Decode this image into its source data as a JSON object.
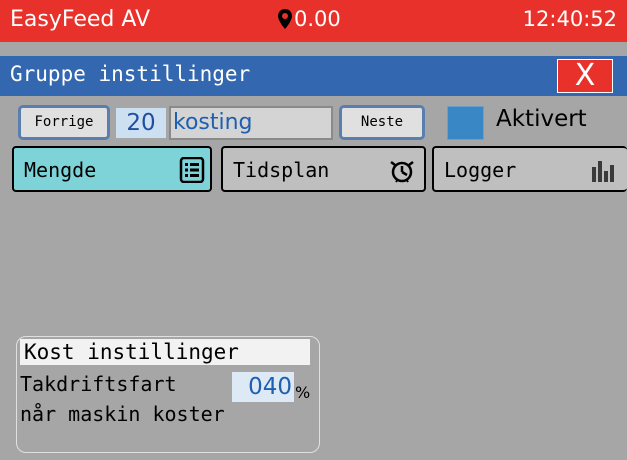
{
  "status_bar": {
    "app_name": "EasyFeed AV",
    "location_value": "0.00",
    "time": "12:40:52"
  },
  "title_bar": {
    "title": "Gruppe instillinger",
    "close_label": "X"
  },
  "group_nav": {
    "prev_label": "Forrige",
    "group_number": "20",
    "group_name": "kosting",
    "next_label": "Neste",
    "active_label": "Aktivert",
    "active_checked": false
  },
  "tabs": [
    {
      "label": "Mengde",
      "icon": "list-icon",
      "selected": true
    },
    {
      "label": "Tidsplan",
      "icon": "timer-icon",
      "selected": false
    },
    {
      "label": "Logger",
      "icon": "bar-chart-icon",
      "selected": false
    }
  ],
  "cost_settings": {
    "title": "Kost instillinger",
    "label_line1": "Takdriftsfart",
    "value": "040",
    "unit": "%",
    "label_line2": "når maskin koster"
  },
  "colors": {
    "status_bar": "#e8312a",
    "title_bar": "#3368b0",
    "tab_selected": "#7ed3d8",
    "background": "#a6a6a6"
  }
}
